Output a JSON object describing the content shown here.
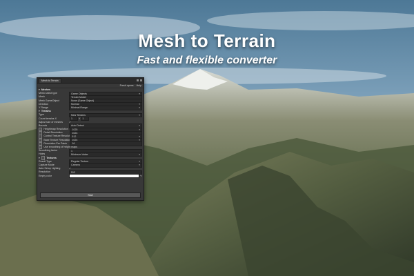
{
  "headline": {
    "title": "Mesh to Terrain",
    "subtitle": "Fast and flexible converter"
  },
  "window": {
    "tab_label": "Mesh to Terrain",
    "toolbar": {
      "history": "Fresh opens",
      "help": "Help"
    },
    "mesh_section": "Meshes",
    "rows_mesh": [
      {
        "label": "Mesh select type",
        "value": "Game Objects"
      },
      {
        "label": "Mesh",
        "value": "Terrain Model"
      },
      {
        "label": "Mesh GameObject",
        "value": "None (Game Object)"
      },
      {
        "label": "Direction",
        "value": "Normal"
      },
      {
        "label": "Y Range",
        "value": "Minimal Range"
      }
    ],
    "terrain_section": "Terrains",
    "terrain_type": {
      "label": "Type",
      "value": "New Terrains"
    },
    "count_terrains": {
      "label": "Count terrains X",
      "x": "1",
      "y_label": "Y",
      "y": "1"
    },
    "adjust_label": "Adjust size of meshes",
    "bounds": {
      "label": "Bounds",
      "value": "Auto Detect"
    },
    "resolutions": [
      {
        "label": "Heightmap Resolution",
        "value": "1025"
      },
      {
        "label": "Detail Resolution",
        "value": "1024"
      },
      {
        "label": "Control Texture Resolution",
        "value": "512"
      },
      {
        "label": "Base Texture Resolution",
        "value": "1024"
      },
      {
        "label": "Resolution Per Patch",
        "value": "16"
      }
    ],
    "smoothing_label": "Use smoothing of height maps",
    "smoothing_factor": {
      "label": "Smoothing factor",
      "value": "1"
    },
    "holes": {
      "label": "Holes",
      "value": "Minimum Value"
    },
    "textures_section": "Textures",
    "textures": [
      {
        "label": "Result Type",
        "value": "Regular Texture"
      },
      {
        "label": "Capture Mode",
        "value": "Camera"
      }
    ],
    "auto_lighting_label": "Auto Setup Lighting",
    "tex_resolution": {
      "label": "Resolution",
      "value": "512"
    },
    "empty_color_label": "Empty color",
    "start_label": "Start"
  }
}
